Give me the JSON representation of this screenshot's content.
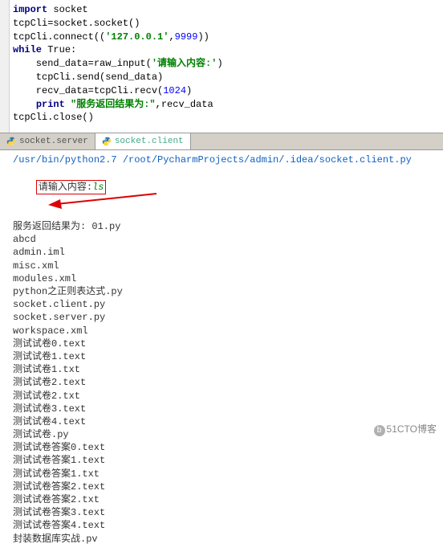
{
  "code": {
    "l1_kw": "import",
    "l1_rest": " socket",
    "l2": "tcpCli=socket.socket()",
    "l3a": "tcpCli.connect((",
    "l3_str": "'127.0.0.1'",
    "l3b": ",",
    "l3_num": "9999",
    "l3c": "))",
    "l4_kw": "while",
    "l4_rest": " True:",
    "l5a": "    send_data=raw_input(",
    "l5_str": "'请输入内容:'",
    "l5b": ")",
    "l6": "    tcpCli.send(send_data)",
    "l7a": "    recv_data=tcpCli.recv(",
    "l7_num": "1024",
    "l7b": ")",
    "l8a": "    ",
    "l8_kw": "print",
    "l8b": " ",
    "l8_str": "\"服务返回结果为:\"",
    "l8c": ",recv_data",
    "l9": "tcpCli.close()"
  },
  "tabs": {
    "inactive": "socket.server",
    "active": "socket.client"
  },
  "console": {
    "path": "/usr/bin/python2.7 /root/PycharmProjects/admin/.idea/socket.client.py",
    "prompt": "请输入内容:",
    "input": "ls",
    "result_prefix": "服务返回结果为: 01.py",
    "lines": [
      "abcd",
      "admin.iml",
      "misc.xml",
      "modules.xml",
      "python之正则表达式.py",
      "socket.client.py",
      "socket.server.py",
      "workspace.xml",
      "测试试卷0.text",
      "测试试卷1.text",
      "测试试卷1.txt",
      "测试试卷2.text",
      "测试试卷2.txt",
      "测试试卷3.text",
      "测试试卷4.text",
      "测试试卷.py",
      "测试试卷答案0.text",
      "测试试卷答案1.text",
      "测试试卷答案1.txt",
      "测试试卷答案2.text",
      "测试试卷答案2.txt",
      "测试试卷答案3.text",
      "测试试卷答案4.text",
      "封装数据库实战.pv"
    ]
  },
  "watermark": "51CTO博客"
}
